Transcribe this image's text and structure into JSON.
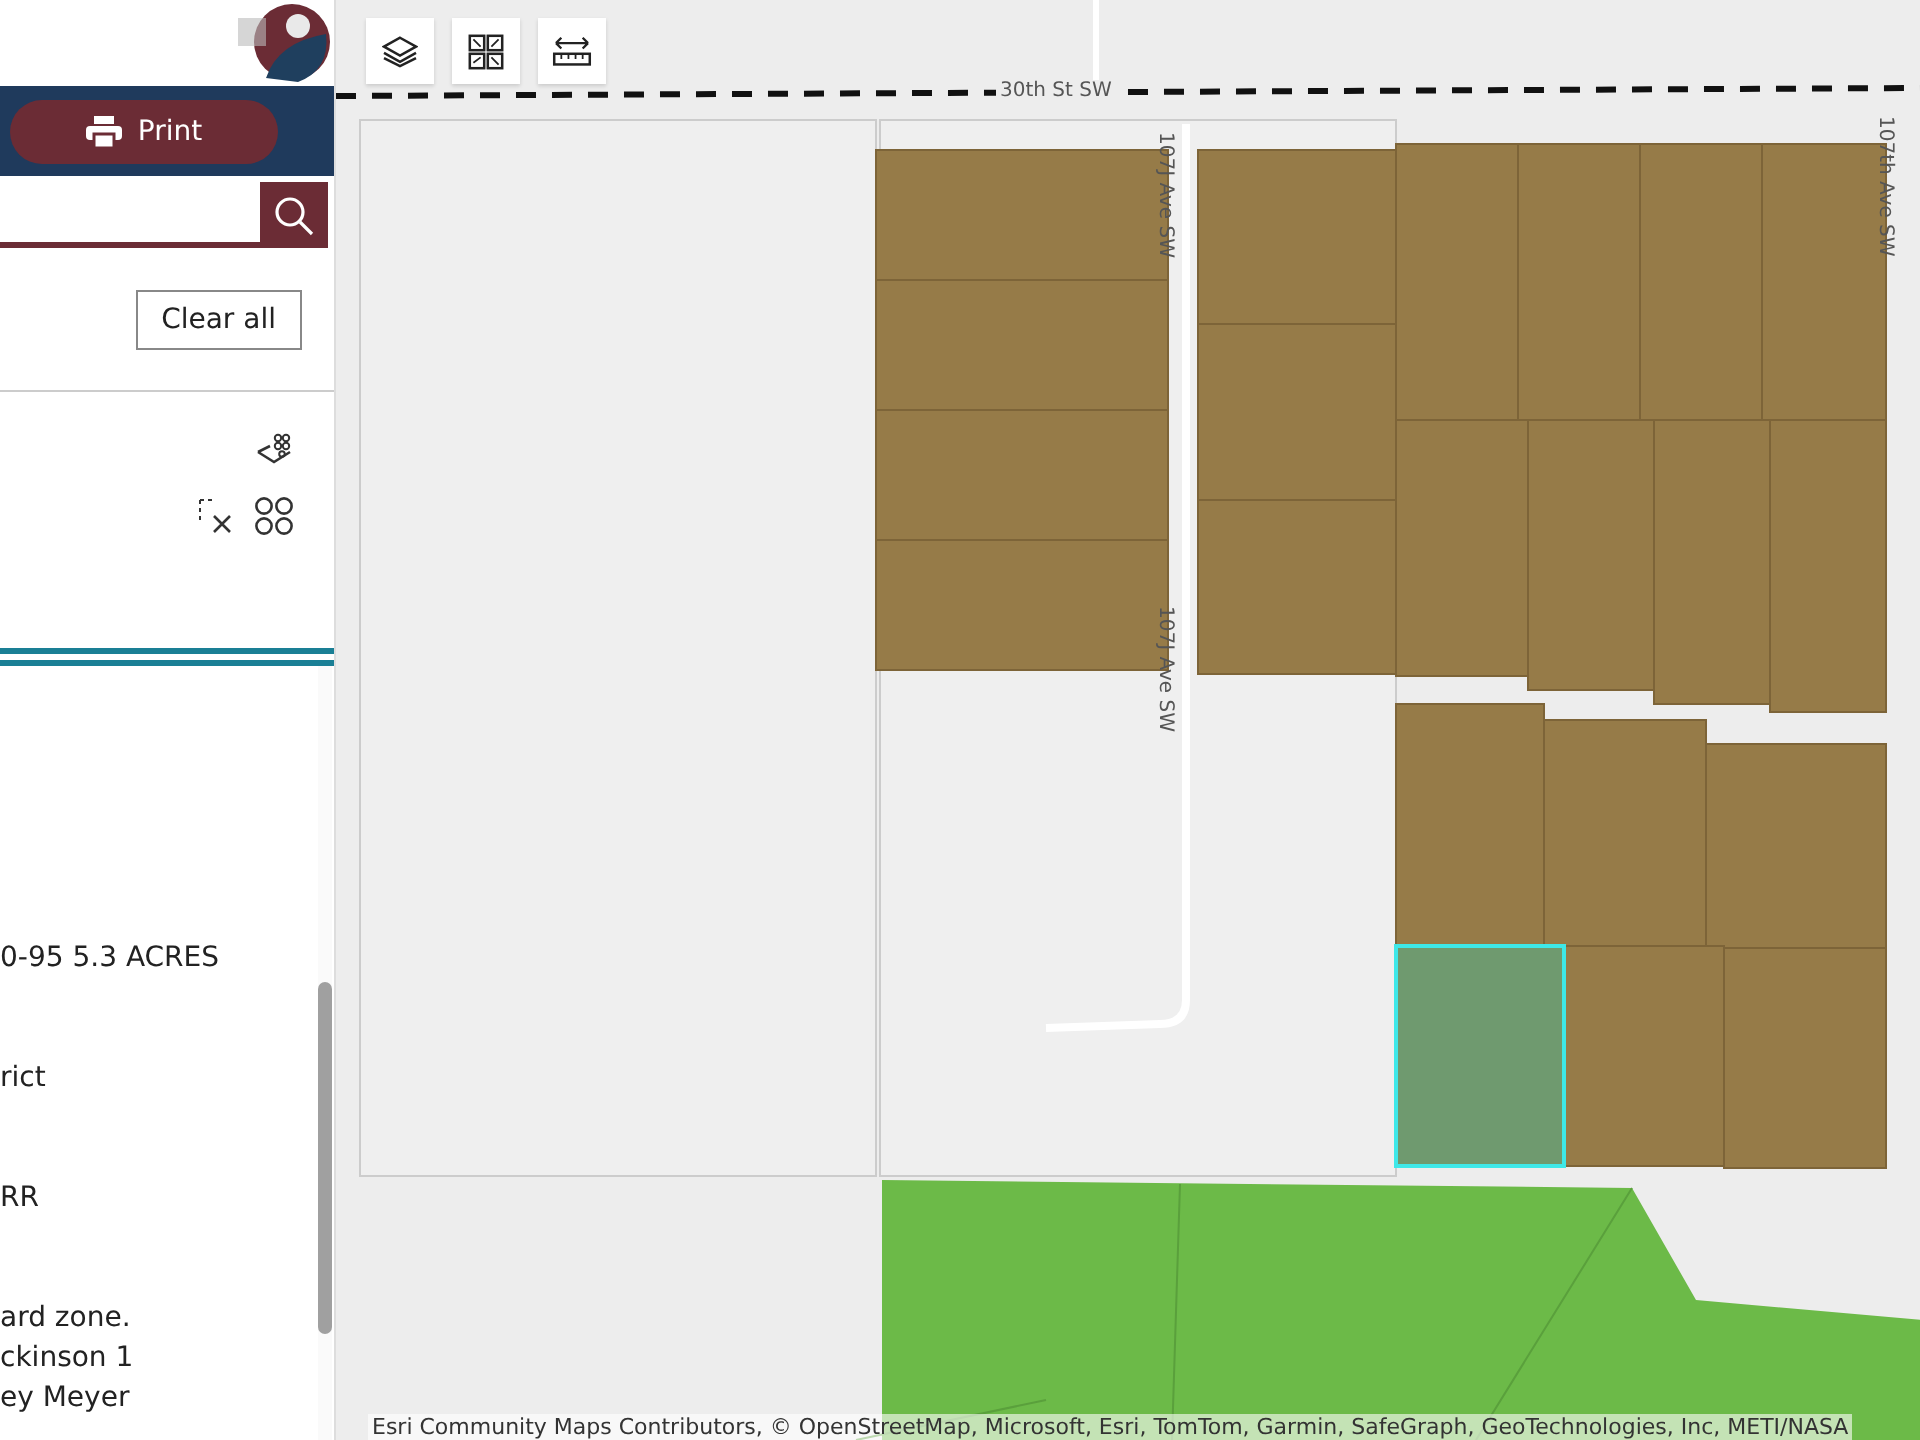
{
  "panel": {
    "print_button": {
      "label": "Print"
    },
    "clear_all_button": {
      "label": "Clear all"
    },
    "details": [
      [
        "0-95 5.3 ACRES"
      ],
      [
        "rict"
      ],
      [
        "RR"
      ],
      [
        "ard zone.",
        "ckinson 1",
        "ey Meyer"
      ]
    ]
  },
  "map": {
    "road_labels": [
      {
        "text": "30th St SW",
        "kind": "horizontal"
      },
      {
        "text": "107J Ave SW",
        "kind": "vertical"
      },
      {
        "text": "107J Ave SW",
        "kind": "vertical"
      },
      {
        "text": "107th Ave SW",
        "kind": "vertical"
      }
    ],
    "attribution": "Esri Community Maps Contributors, © OpenStreetMap, Microsoft, Esri, TomTom, Garmin, SafeGraph, GeoTechnologies, Inc, METI/NASA"
  }
}
